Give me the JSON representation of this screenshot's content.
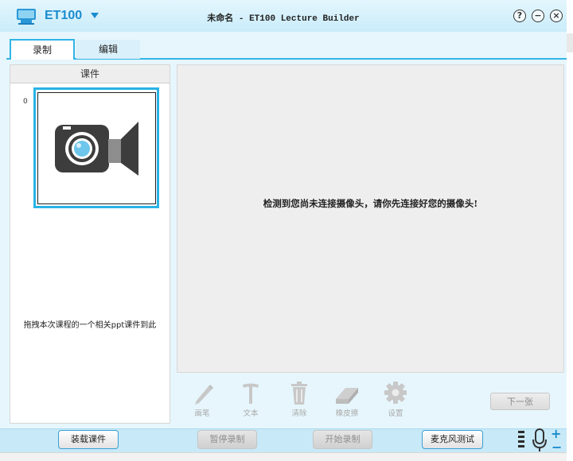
{
  "window": {
    "brand": "ET100",
    "title": "未命名 - ET100 Lecture Builder",
    "help_glyph": "?",
    "minimize_glyph": "−",
    "close_glyph": "×"
  },
  "tabs": [
    {
      "label": "录制",
      "active": true
    },
    {
      "label": "编辑",
      "active": false
    }
  ],
  "courseware": {
    "header": "课件",
    "slide_index": "0",
    "drag_hint": "拖拽本次课程的一个相关ppt课件到此"
  },
  "camera": {
    "message": "检测到您尚未连接摄像头，请你先连接好您的摄像头!"
  },
  "tools": [
    {
      "icon": "pen-icon",
      "label": "画笔"
    },
    {
      "icon": "text-icon",
      "label": "文本"
    },
    {
      "icon": "trash-icon",
      "label": "清除"
    },
    {
      "icon": "eraser-icon",
      "label": "橡皮擦"
    },
    {
      "icon": "gear-icon",
      "label": "设置"
    }
  ],
  "next_button": "下一张",
  "bottom": {
    "load_courseware": "装载课件",
    "pause_record": "暂停录制",
    "start_record": "开始录制",
    "mic_test": "麦克风测试",
    "volume_plus": "+",
    "volume_minus": "−"
  },
  "colors": {
    "accent": "#29b3e6",
    "brand": "#1a8ccf",
    "titlebar": "#d4f0fb"
  }
}
